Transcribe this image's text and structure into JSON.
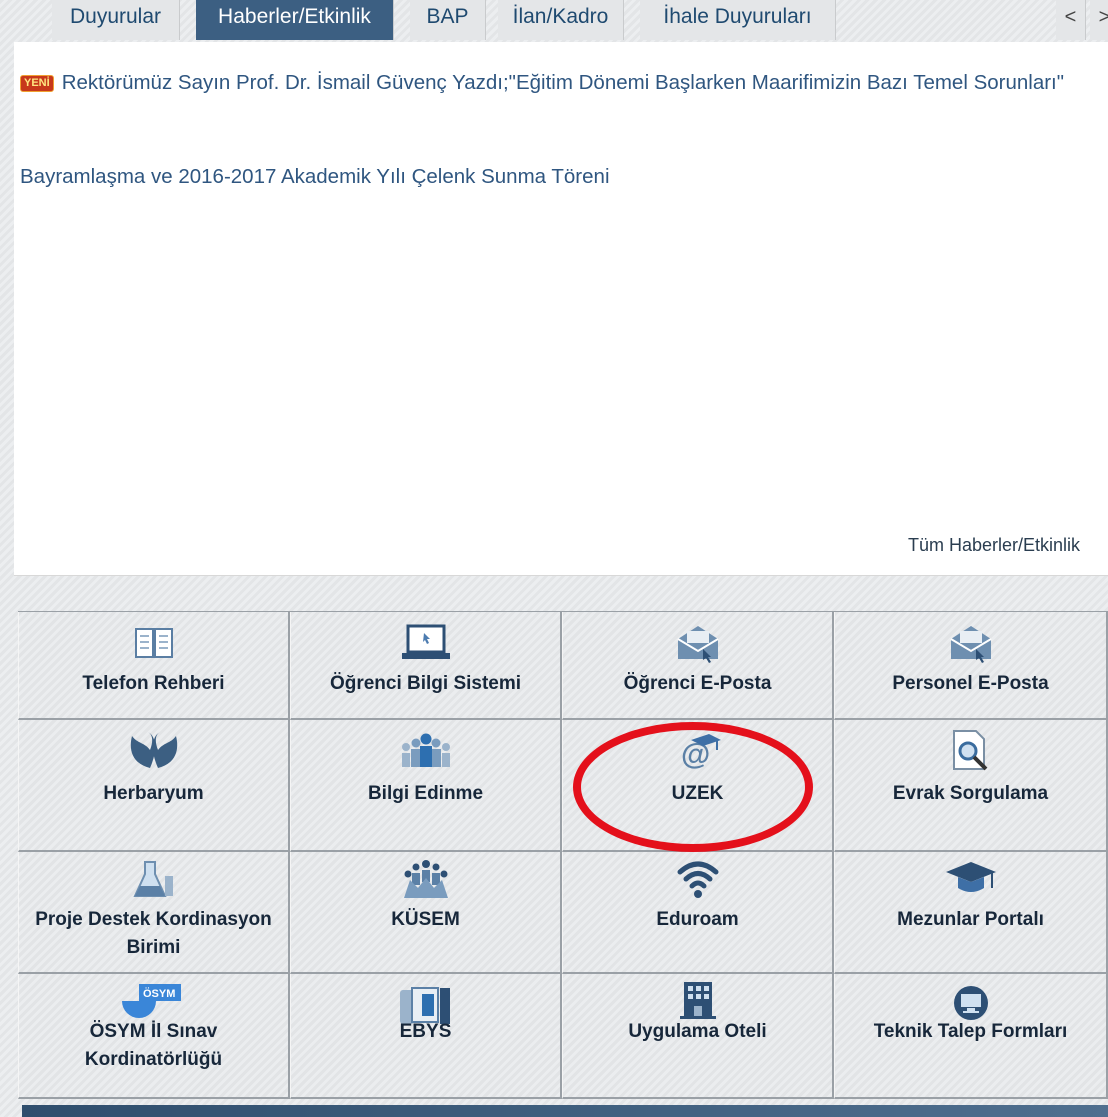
{
  "tabs": [
    {
      "label": "Duyurular"
    },
    {
      "label": "Haberler/Etkinlik"
    },
    {
      "label": "BAP"
    },
    {
      "label": "İlan/Kadro"
    },
    {
      "label": "İhale Duyuruları"
    },
    {
      "label": "<"
    },
    {
      "label": ">"
    }
  ],
  "news": {
    "badge": "YENİ",
    "items": [
      "Rektörümüz Sayın Prof. Dr. İsmail Güvenç Yazdı;\"Eğitim Dönemi Başlarken Maarifimizin Bazı Temel Sorunları\"",
      "Bayramlaşma ve 2016-2017 Akademik Yılı Çelenk Sunma Töreni"
    ],
    "all_link": "Tüm Haberler/Etkinlik"
  },
  "links": [
    {
      "label": "Telefon Rehberi",
      "icon": "book-icon"
    },
    {
      "label": "Öğrenci Bilgi Sistemi",
      "icon": "laptop-icon"
    },
    {
      "label": "Öğrenci E-Posta",
      "icon": "envelope-icon"
    },
    {
      "label": "Personel E-Posta",
      "icon": "envelope-icon"
    },
    {
      "label": "Herbaryum",
      "icon": "leaf-icon"
    },
    {
      "label": "Bilgi Edinme",
      "icon": "people-icon"
    },
    {
      "label": "UZEK",
      "icon": "at-graduation-icon"
    },
    {
      "label": "Evrak Sorgulama",
      "icon": "document-search-icon"
    },
    {
      "label": "Proje Destek Kordinasyon Birimi",
      "icon": "flask-icon"
    },
    {
      "label": "KÜSEM",
      "icon": "group-icon"
    },
    {
      "label": "Eduroam",
      "icon": "wifi-icon"
    },
    {
      "label": "Mezunlar Portalı",
      "icon": "graduation-cap-icon"
    },
    {
      "label": "ÖSYM İl Sınav Kordinatörlüğü",
      "icon": "osym-logo-icon",
      "icon_text": "ÖSYM"
    },
    {
      "label": "EBYS",
      "icon": "computer-icon"
    },
    {
      "label": "Uygulama Oteli",
      "icon": "building-icon"
    },
    {
      "label": "Teknik Talep Formları",
      "icon": "monitor-support-icon"
    }
  ],
  "colors": {
    "active_tab": "#3c5f82",
    "link_text": "#2f5680",
    "highlight": "#e4101b"
  }
}
